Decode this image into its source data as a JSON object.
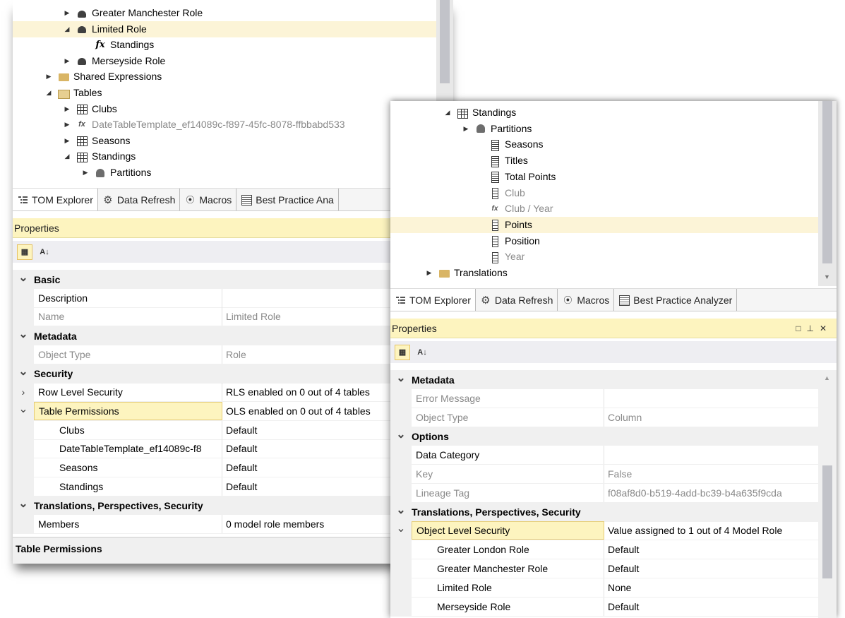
{
  "left_panel": {
    "tree": [
      {
        "label": "Greater Manchester Role",
        "icon": "role-icon",
        "expander": "collapsed"
      },
      {
        "label": "Limited Role",
        "icon": "role-icon",
        "expander": "expanded",
        "selected": true
      },
      {
        "label": "Standings",
        "icon": "fx-icon",
        "expander": "none"
      },
      {
        "label": "Merseyside Role",
        "icon": "role-icon",
        "expander": "collapsed"
      },
      {
        "label": "Shared Expressions",
        "icon": "folder-icon",
        "expander": "collapsed"
      },
      {
        "label": "Tables",
        "icon": "folder-open-icon",
        "expander": "expanded"
      },
      {
        "label": "Clubs",
        "icon": "table-icon",
        "expander": "collapsed"
      },
      {
        "label": "DateTableTemplate_ef14089c-f897-45fc-8078-ffbbabd533",
        "icon": "calc-table-icon",
        "expander": "collapsed",
        "dimmed": true
      },
      {
        "label": "Seasons",
        "icon": "table-icon",
        "expander": "collapsed"
      },
      {
        "label": "Standings",
        "icon": "table-icon",
        "expander": "expanded"
      },
      {
        "label": "Partitions",
        "icon": "partitions-icon",
        "expander": "collapsed"
      }
    ],
    "tabs": [
      {
        "label": "TOM Explorer",
        "icon": "tom-explorer-icon",
        "active": true
      },
      {
        "label": "Data Refresh",
        "icon": "data-refresh-icon"
      },
      {
        "label": "Macros",
        "icon": "macros-icon"
      },
      {
        "label": "Best Practice Ana",
        "icon": "best-practice-icon"
      }
    ],
    "properties_title": "Properties",
    "grid": [
      {
        "type": "category",
        "label": "Basic",
        "chevron": "v"
      },
      {
        "label": "Description",
        "value": ""
      },
      {
        "label": "Name",
        "value": "Limited Role",
        "readonly": true
      },
      {
        "type": "category",
        "label": "Metadata",
        "chevron": "v"
      },
      {
        "label": "Object Type",
        "value": "Role",
        "readonly": true
      },
      {
        "type": "category",
        "label": "Security",
        "chevron": "v"
      },
      {
        "label": "Row Level Security",
        "value": "RLS enabled on 0 out of 4 tables",
        "gut": ">"
      },
      {
        "label": "Table Permissions",
        "value": "OLS enabled on 0 out of 4 tables",
        "gut": "v",
        "highlight": true
      },
      {
        "label": "Clubs",
        "value": "Default",
        "sub": true
      },
      {
        "label": "DateTableTemplate_ef14089c-f8",
        "value": "Default",
        "sub": true
      },
      {
        "label": "Seasons",
        "value": "Default",
        "sub": true
      },
      {
        "label": "Standings",
        "value": "Default",
        "sub": true
      },
      {
        "type": "category",
        "label": "Translations, Perspectives, Security",
        "chevron": "v"
      },
      {
        "label": "Members",
        "value": "0 model role members"
      }
    ],
    "description_title": "Table Permissions"
  },
  "right_panel": {
    "tree": [
      {
        "label": "Standings",
        "icon": "table-icon",
        "expander": "expanded"
      },
      {
        "label": "Partitions",
        "icon": "partitions-icon",
        "expander": "collapsed"
      },
      {
        "label": "Seasons",
        "icon": "measure-icon",
        "expander": "none"
      },
      {
        "label": "Titles",
        "icon": "measure-icon",
        "expander": "none"
      },
      {
        "label": "Total Points",
        "icon": "measure-icon",
        "expander": "none"
      },
      {
        "label": "Club",
        "icon": "column-icon",
        "expander": "none",
        "dimmed": true
      },
      {
        "label": "Club / Year",
        "icon": "calc-column-icon",
        "expander": "none",
        "dimmed": true
      },
      {
        "label": "Points",
        "icon": "column-icon",
        "expander": "none",
        "selected": true
      },
      {
        "label": "Position",
        "icon": "column-icon",
        "expander": "none"
      },
      {
        "label": "Year",
        "icon": "column-icon",
        "expander": "none",
        "dimmed": true
      },
      {
        "label": "Translations",
        "icon": "folder-icon",
        "expander": "collapsed"
      }
    ],
    "tabs": [
      {
        "label": "TOM Explorer",
        "icon": "tom-explorer-icon",
        "active": true
      },
      {
        "label": "Data Refresh",
        "icon": "data-refresh-icon"
      },
      {
        "label": "Macros",
        "icon": "macros-icon"
      },
      {
        "label": "Best Practice Analyzer",
        "icon": "best-practice-icon"
      }
    ],
    "properties_title": "Properties",
    "grid": [
      {
        "type": "category",
        "label": "Metadata",
        "chevron": "v"
      },
      {
        "label": "Error Message",
        "value": "",
        "readonly": true
      },
      {
        "label": "Object Type",
        "value": "Column",
        "readonly": true
      },
      {
        "type": "category",
        "label": "Options",
        "chevron": "v"
      },
      {
        "label": "Data Category",
        "value": ""
      },
      {
        "label": "Key",
        "value": "False",
        "readonly": true
      },
      {
        "label": "Lineage Tag",
        "value": "f08af8d0-b519-4add-bc39-b4a635f9cda",
        "readonly": true
      },
      {
        "type": "category",
        "label": "Translations, Perspectives, Security",
        "chevron": "v"
      },
      {
        "label": "Object Level Security",
        "value": "Value assigned to 1 out of 4 Model Role",
        "gut": "v",
        "highlight": true
      },
      {
        "label": "Greater London Role",
        "value": "Default",
        "sub": true
      },
      {
        "label": "Greater Manchester Role",
        "value": "Default",
        "sub": true
      },
      {
        "label": "Limited Role",
        "value": "None",
        "sub": true
      },
      {
        "label": "Merseyside Role",
        "value": "Default",
        "sub": true
      }
    ]
  }
}
